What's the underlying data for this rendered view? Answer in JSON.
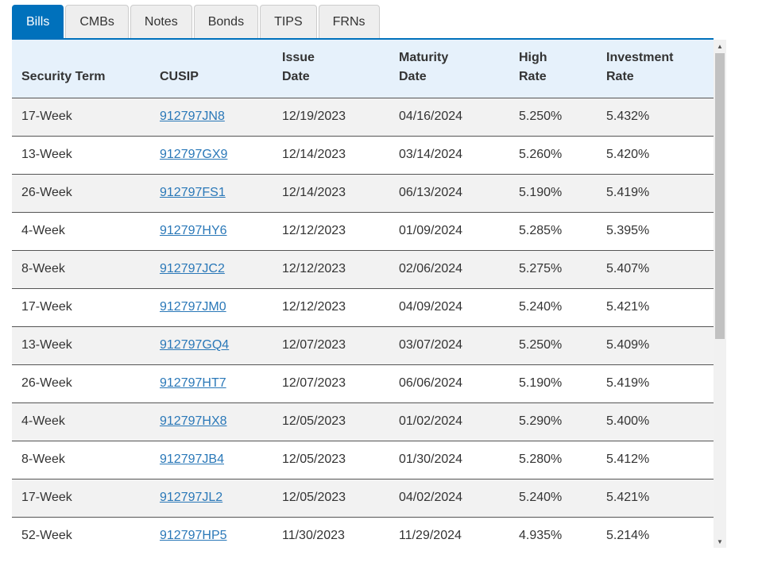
{
  "tabs": [
    {
      "label": "Bills",
      "active": true
    },
    {
      "label": "CMBs",
      "active": false
    },
    {
      "label": "Notes",
      "active": false
    },
    {
      "label": "Bonds",
      "active": false
    },
    {
      "label": "TIPS",
      "active": false
    },
    {
      "label": "FRNs",
      "active": false
    }
  ],
  "table": {
    "headers": {
      "security_term": [
        "Security Term"
      ],
      "cusip": [
        "CUSIP"
      ],
      "issue_date": [
        "Issue",
        "Date"
      ],
      "maturity_date": [
        "Maturity",
        "Date"
      ],
      "high_rate": [
        "High",
        "Rate"
      ],
      "investment_rate": [
        "Investment",
        "Rate"
      ]
    },
    "rows": [
      {
        "term": "17-Week",
        "cusip": "912797JN8",
        "issue": "12/19/2023",
        "maturity": "04/16/2024",
        "high": "5.250%",
        "invest": "5.432%"
      },
      {
        "term": "13-Week",
        "cusip": "912797GX9",
        "issue": "12/14/2023",
        "maturity": "03/14/2024",
        "high": "5.260%",
        "invest": "5.420%"
      },
      {
        "term": "26-Week",
        "cusip": "912797FS1",
        "issue": "12/14/2023",
        "maturity": "06/13/2024",
        "high": "5.190%",
        "invest": "5.419%"
      },
      {
        "term": "4-Week",
        "cusip": "912797HY6",
        "issue": "12/12/2023",
        "maturity": "01/09/2024",
        "high": "5.285%",
        "invest": "5.395%"
      },
      {
        "term": "8-Week",
        "cusip": "912797JC2",
        "issue": "12/12/2023",
        "maturity": "02/06/2024",
        "high": "5.275%",
        "invest": "5.407%"
      },
      {
        "term": "17-Week",
        "cusip": "912797JM0",
        "issue": "12/12/2023",
        "maturity": "04/09/2024",
        "high": "5.240%",
        "invest": "5.421%"
      },
      {
        "term": "13-Week",
        "cusip": "912797GQ4",
        "issue": "12/07/2023",
        "maturity": "03/07/2024",
        "high": "5.250%",
        "invest": "5.409%"
      },
      {
        "term": "26-Week",
        "cusip": "912797HT7",
        "issue": "12/07/2023",
        "maturity": "06/06/2024",
        "high": "5.190%",
        "invest": "5.419%"
      },
      {
        "term": "4-Week",
        "cusip": "912797HX8",
        "issue": "12/05/2023",
        "maturity": "01/02/2024",
        "high": "5.290%",
        "invest": "5.400%"
      },
      {
        "term": "8-Week",
        "cusip": "912797JB4",
        "issue": "12/05/2023",
        "maturity": "01/30/2024",
        "high": "5.280%",
        "invest": "5.412%"
      },
      {
        "term": "17-Week",
        "cusip": "912797JL2",
        "issue": "12/05/2023",
        "maturity": "04/02/2024",
        "high": "5.240%",
        "invest": "5.421%"
      },
      {
        "term": "52-Week",
        "cusip": "912797HP5",
        "issue": "11/30/2023",
        "maturity": "11/29/2024",
        "high": "4.935%",
        "invest": "5.214%"
      }
    ]
  },
  "scrollbar": {
    "up_icon": "triangle-up",
    "down_icon": "triangle-down"
  },
  "colors": {
    "active_tab": "#0071bc",
    "header_bg": "#e6f1fb",
    "link": "#2a78b8"
  }
}
